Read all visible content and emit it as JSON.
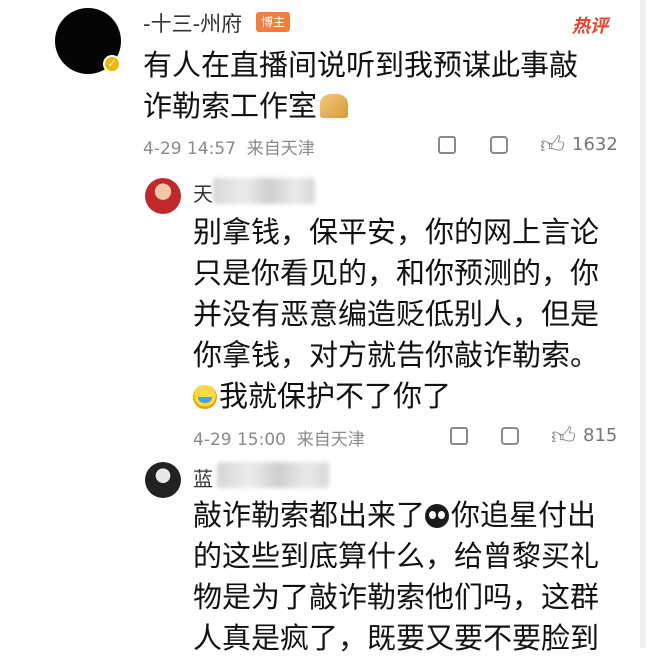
{
  "post": {
    "username": "-十三-州府",
    "badge": "博主",
    "hot_label": "热评",
    "text": "有人在直播间说听到我预谋此事敲诈勒索工作室",
    "time": "4-29 14:57",
    "location": "来自天津",
    "likes": "1632"
  },
  "replies": [
    {
      "name_prefix": "天",
      "text": "别拿钱，保平安，你的网上言论只是你看见的，和你预测的，你并没有恶意编造贬低别人，但是你拿钱，对方就告你敲诈勒索。",
      "text_after_emoji": "我就保护不了你了",
      "time": "4-29 15:00",
      "location": "来自天津",
      "likes": "815"
    },
    {
      "name_prefix": "蓝",
      "text_before_emoji": "敲诈勒索都出来了",
      "text_after_emoji": "你追星付出的这些到底算什么，给曾黎买礼物是为了敲诈勒索他们吗，这群人真是疯了，既要又要不要脸到"
    }
  ],
  "icons": [
    "share-icon",
    "comment-icon",
    "like-icon",
    "verified-icon",
    "praying-hands-emoji",
    "crying-laugh-emoji",
    "eyes-emoji"
  ]
}
